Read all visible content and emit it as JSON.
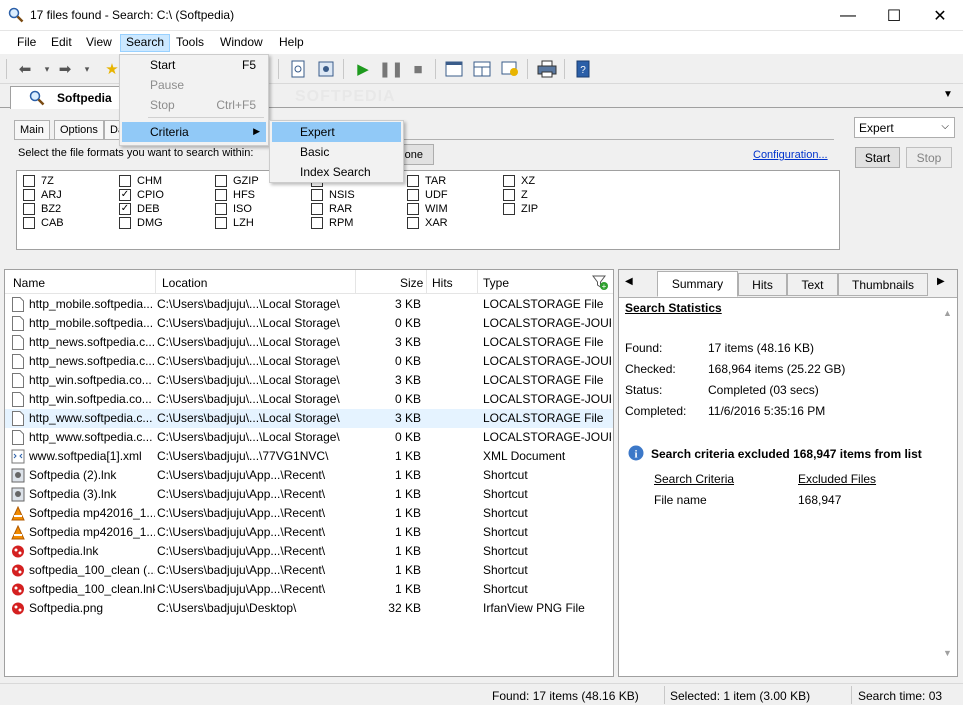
{
  "window": {
    "title": "17 files found - Search: C:\\ (Softpedia)",
    "minimize": "—",
    "maximize": "☐",
    "close": "✕"
  },
  "menubar": [
    "File",
    "Edit",
    "View",
    "Search",
    "Tools",
    "Window",
    "Help"
  ],
  "search_menu": {
    "items": [
      {
        "label": "Start",
        "shortcut": "F5",
        "disabled": false
      },
      {
        "label": "Pause",
        "shortcut": "",
        "disabled": true
      },
      {
        "label": "Stop",
        "shortcut": "Ctrl+F5",
        "disabled": true
      },
      {
        "label": "Criteria",
        "shortcut": "",
        "disabled": false
      }
    ]
  },
  "criteria_menu": {
    "items": [
      "Expert",
      "Basic",
      "Index Search"
    ]
  },
  "doc_tab": {
    "label": "Softpedia",
    "watermark": "SOFTPEDIA"
  },
  "criteria_panel": {
    "subtabs": [
      "Main",
      "Options",
      "Da"
    ],
    "instruction": "Select the file formats you want to search within:",
    "none_button": "one",
    "configuration_link": "Configuration...",
    "formats": [
      [
        "7Z",
        "ARJ",
        "BZ2",
        "CAB"
      ],
      [
        "CHM",
        "CPIO",
        "DEB",
        "DMG"
      ],
      [
        "GZIP",
        "HFS",
        "ISO",
        "LZH"
      ],
      [
        "",
        "NSIS",
        "RAR",
        "RPM"
      ],
      [
        "TAR",
        "UDF",
        "WIM",
        "XAR"
      ],
      [
        "XZ",
        "Z",
        "ZIP",
        ""
      ]
    ],
    "checked": [
      "CPIO",
      "DEB"
    ]
  },
  "right_controls": {
    "mode_select": "Expert",
    "start_button": "Start",
    "stop_button": "Stop"
  },
  "list": {
    "columns": [
      "Name",
      "Location",
      "Size",
      "Hits",
      "Type"
    ],
    "rows": [
      {
        "name": "http_mobile.softpedia...",
        "location": "C:\\Users\\badjuju\\...\\Local Storage\\",
        "size": "3 KB",
        "type": "LOCALSTORAGE File",
        "icon": "doc"
      },
      {
        "name": "http_mobile.softpedia...",
        "location": "C:\\Users\\badjuju\\...\\Local Storage\\",
        "size": "0 KB",
        "type": "LOCALSTORAGE-JOURN",
        "icon": "doc"
      },
      {
        "name": "http_news.softpedia.c...",
        "location": "C:\\Users\\badjuju\\...\\Local Storage\\",
        "size": "3 KB",
        "type": "LOCALSTORAGE File",
        "icon": "doc"
      },
      {
        "name": "http_news.softpedia.c...",
        "location": "C:\\Users\\badjuju\\...\\Local Storage\\",
        "size": "0 KB",
        "type": "LOCALSTORAGE-JOURN",
        "icon": "doc"
      },
      {
        "name": "http_win.softpedia.co...",
        "location": "C:\\Users\\badjuju\\...\\Local Storage\\",
        "size": "3 KB",
        "type": "LOCALSTORAGE File",
        "icon": "doc"
      },
      {
        "name": "http_win.softpedia.co...",
        "location": "C:\\Users\\badjuju\\...\\Local Storage\\",
        "size": "0 KB",
        "type": "LOCALSTORAGE-JOURN",
        "icon": "doc"
      },
      {
        "name": "http_www.softpedia.c...",
        "location": "C:\\Users\\badjuju\\...\\Local Storage\\",
        "size": "3 KB",
        "type": "LOCALSTORAGE File",
        "icon": "doc",
        "selected": true
      },
      {
        "name": "http_www.softpedia.c...",
        "location": "C:\\Users\\badjuju\\...\\Local Storage\\",
        "size": "0 KB",
        "type": "LOCALSTORAGE-JOURN",
        "icon": "doc"
      },
      {
        "name": "www.softpedia[1].xml",
        "location": "C:\\Users\\badjuju\\...\\77VG1NVC\\",
        "size": "1 KB",
        "type": "XML Document",
        "icon": "xml"
      },
      {
        "name": "Softpedia (2).lnk",
        "location": "C:\\Users\\badjuju\\App...\\Recent\\",
        "size": "1 KB",
        "type": "Shortcut",
        "icon": "lnk"
      },
      {
        "name": "Softpedia (3).lnk",
        "location": "C:\\Users\\badjuju\\App...\\Recent\\",
        "size": "1 KB",
        "type": "Shortcut",
        "icon": "lnk"
      },
      {
        "name": "Softpedia mp42016_1...",
        "location": "C:\\Users\\badjuju\\App...\\Recent\\",
        "size": "1 KB",
        "type": "Shortcut",
        "icon": "vlc"
      },
      {
        "name": "Softpedia mp42016_1...",
        "location": "C:\\Users\\badjuju\\App...\\Recent\\",
        "size": "1 KB",
        "type": "Shortcut",
        "icon": "vlc"
      },
      {
        "name": "Softpedia.lnk",
        "location": "C:\\Users\\badjuju\\App...\\Recent\\",
        "size": "1 KB",
        "type": "Shortcut",
        "icon": "irfan"
      },
      {
        "name": "softpedia_100_clean (...",
        "location": "C:\\Users\\badjuju\\App...\\Recent\\",
        "size": "1 KB",
        "type": "Shortcut",
        "icon": "irfan"
      },
      {
        "name": "softpedia_100_clean.lnk",
        "location": "C:\\Users\\badjuju\\App...\\Recent\\",
        "size": "1 KB",
        "type": "Shortcut",
        "icon": "irfan"
      },
      {
        "name": "Softpedia.png",
        "location": "C:\\Users\\badjuju\\Desktop\\",
        "size": "32 KB",
        "type": "IrfanView PNG File",
        "icon": "irfan"
      }
    ]
  },
  "right_pane": {
    "tabs": [
      "Summary",
      "Hits",
      "Text",
      "Thumbnails"
    ],
    "active_tab": "Summary",
    "heading": "Search Statistics",
    "stats": [
      {
        "label": "Found:",
        "value": "17 items (48.16 KB)"
      },
      {
        "label": "Checked:",
        "value": "168,964 items (25.22 GB)"
      },
      {
        "label": "Status:",
        "value": "Completed (03 secs)"
      },
      {
        "label": "Completed:",
        "value": "11/6/2016 5:35:16 PM"
      }
    ],
    "excluded_note": "Search criteria excluded 168,947 items from list",
    "excluded_header": [
      "Search Criteria",
      "Excluded Files"
    ],
    "excluded_row": [
      "File name",
      "168,947"
    ]
  },
  "statusbar": {
    "found": "Found: 17 items (48.16 KB)",
    "selected": "Selected: 1 item (3.00 KB)",
    "time": "Search time: 03"
  },
  "colors": {
    "menu_highlight": "#91c9f7",
    "link": "#0033cc",
    "selection": "#e5f3ff"
  }
}
